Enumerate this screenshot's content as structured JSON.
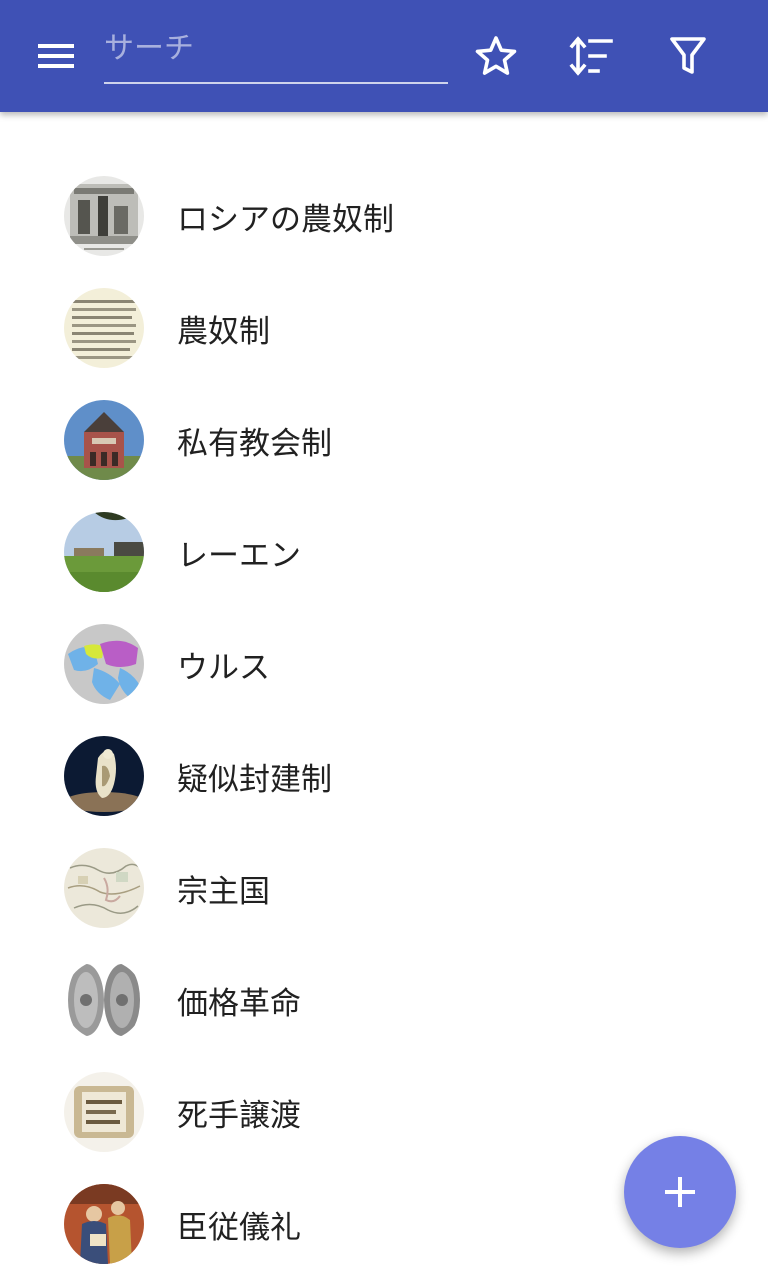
{
  "toolbar": {
    "menu_icon": "menu-icon",
    "search_placeholder": "サーチ",
    "search_value": "",
    "favorites_icon": "star-outline-icon",
    "sort_icon": "sort-icon",
    "filter_icon": "filter-icon",
    "background_color": "#3f51b5"
  },
  "articles": [
    {
      "title": "ロシアの農奴制",
      "thumbnail": "engraving"
    },
    {
      "title": "農奴制",
      "thumbnail": "document"
    },
    {
      "title": "私有教会制",
      "thumbnail": "church"
    },
    {
      "title": "レーエン",
      "thumbnail": "landscape"
    },
    {
      "title": "ウルス",
      "thumbnail": "map"
    },
    {
      "title": "疑似封建制",
      "thumbnail": "statue"
    },
    {
      "title": "宗主国",
      "thumbnail": "old-map"
    },
    {
      "title": "価格革命",
      "thumbnail": "coins"
    },
    {
      "title": "死手譲渡",
      "thumbnail": "manuscript"
    },
    {
      "title": "臣従儀礼",
      "thumbnail": "painting"
    }
  ],
  "fab": {
    "icon": "plus-icon",
    "color": "#7580e6"
  }
}
